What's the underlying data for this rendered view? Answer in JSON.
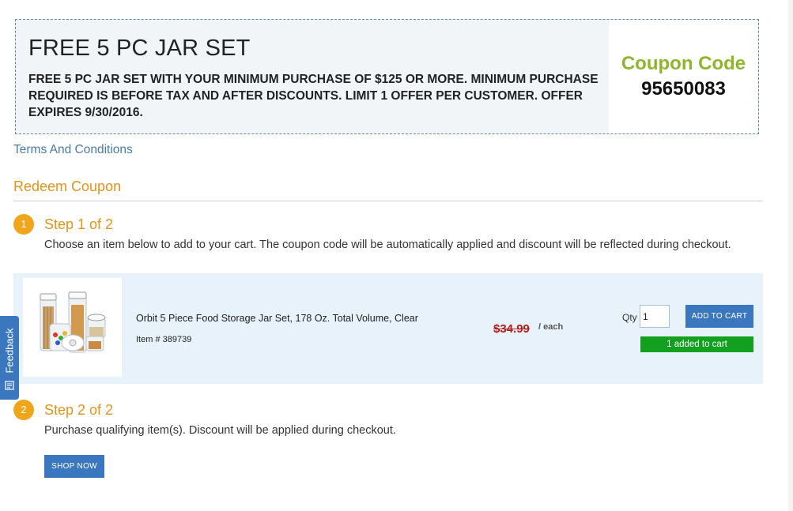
{
  "offer": {
    "title": "FREE 5 PC JAR SET",
    "description": "FREE 5 PC JAR SET WITH YOUR MINIMUM PURCHASE OF $125 OR MORE. MINIMUM PURCHASE REQUIRED IS BEFORE TAX AND AFTER DISCOUNTS. LIMIT 1 OFFER PER CUSTOMER. OFFER EXPIRES 9/30/2016.",
    "coupon_label": "Coupon Code",
    "coupon_code": "95650083"
  },
  "terms_link": "Terms And Conditions",
  "redeem_title": "Redeem Coupon",
  "step1": {
    "number": "1",
    "title": "Step 1 of 2",
    "description": "Choose an item below to add to your cart. The coupon code will be automatically applied and discount will be reflected during checkout."
  },
  "item": {
    "name": "Orbit 5 Piece Food Storage Jar Set, 178 Oz. Total Volume, Clear",
    "item_number": "Item # 389739",
    "price": "$34.99",
    "price_unit": "/ each",
    "qty_label": "Qty",
    "qty_value": "1",
    "add_button": "ADD TO CART",
    "added_status": "1 added to cart"
  },
  "step2": {
    "number": "2",
    "title": "Step 2 of 2",
    "description": "Purchase qualifying item(s). Discount will be applied during checkout.",
    "button": "SHOP NOW"
  },
  "feedback": {
    "label": "Feedback",
    "icon": "feedback-icon"
  },
  "colors": {
    "accent_orange": "#e2941a",
    "coupon_green": "#8fb52a",
    "button_blue": "#3a77bf",
    "added_green": "#12a01e",
    "price_red": "#b01e1e"
  }
}
